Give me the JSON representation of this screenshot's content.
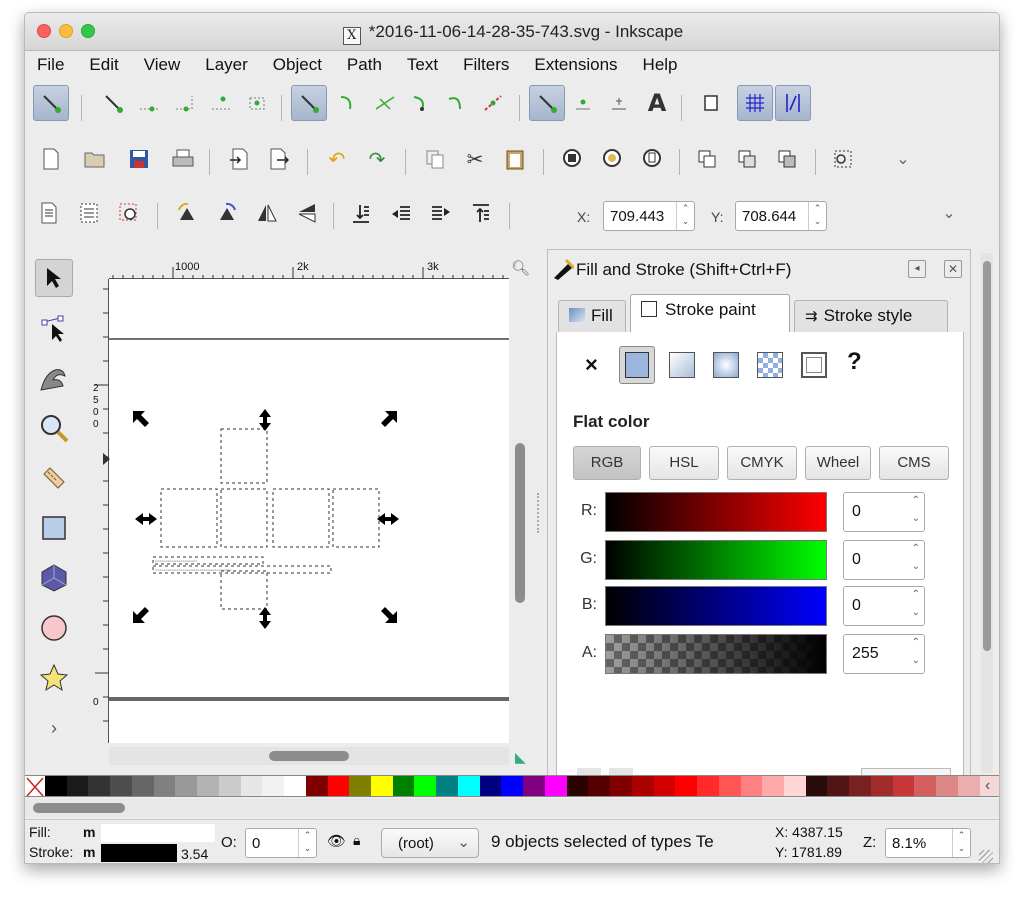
{
  "window": {
    "title": "*2016-11-06-14-28-35-743.svg - Inkscape"
  },
  "menu": [
    "File",
    "Edit",
    "View",
    "Layer",
    "Object",
    "Path",
    "Text",
    "Filters",
    "Extensions",
    "Help"
  ],
  "toolbar3": {
    "x_label": "X:",
    "x_value": "709.443",
    "y_label": "Y:",
    "y_value": "708.644"
  },
  "rulers": {
    "top": [
      "1000",
      "2k",
      "3k"
    ],
    "left_top": [
      "2",
      "5",
      "0",
      "0"
    ],
    "left_bottom": "0"
  },
  "panel": {
    "title": "Fill and Stroke (Shift+Ctrl+F)",
    "tabs": [
      "Fill",
      "Stroke paint",
      "Stroke style"
    ],
    "active_tab": "Stroke paint",
    "unknown_paint_label": "?",
    "no_paint_label": "×",
    "section": "Flat color",
    "modes": [
      "RGB",
      "HSL",
      "CMYK",
      "Wheel",
      "CMS"
    ],
    "active_mode": "RGB",
    "channels": [
      {
        "label": "R:",
        "value": "0",
        "color": "#ff0000"
      },
      {
        "label": "G:",
        "value": "0",
        "color": "#00ff00"
      },
      {
        "label": "B:",
        "value": "0",
        "color": "#0000ff"
      },
      {
        "label": "A:",
        "value": "255",
        "color": "#000000"
      }
    ]
  },
  "palette": [
    "#000000",
    "#1a1a1a",
    "#333333",
    "#4d4d4d",
    "#666666",
    "#808080",
    "#999999",
    "#b3b3b3",
    "#cccccc",
    "#e6e6e6",
    "#f2f2f2",
    "#ffffff",
    "#800000",
    "#ff0000",
    "#808000",
    "#ffff00",
    "#008000",
    "#00ff00",
    "#008080",
    "#00ffff",
    "#000080",
    "#0000ff",
    "#800080",
    "#ff00ff",
    "#2b0000",
    "#550000",
    "#800000",
    "#aa0000",
    "#d40000",
    "#ff0000",
    "#ff2a2a",
    "#ff5555",
    "#ff8080",
    "#ffaaaa",
    "#ffd5d5",
    "#280b0b",
    "#501616",
    "#782121",
    "#a02c2c",
    "#c83737",
    "#d35f5f",
    "#de8787",
    "#e9afaf",
    "#f4d7d7"
  ],
  "status": {
    "fill_label": "Fill:",
    "fill_value": "m",
    "stroke_label": "Stroke:",
    "stroke_value": "m",
    "stroke_width": "3.54",
    "opacity_label": "O:",
    "opacity_value": "0",
    "layer": "(root)",
    "message": "9 objects selected of types Te",
    "x_coord": "X: 4387.15",
    "y_coord": "Y: 1781.89",
    "zoom_label": "Z:",
    "zoom_value": "8.1%"
  }
}
